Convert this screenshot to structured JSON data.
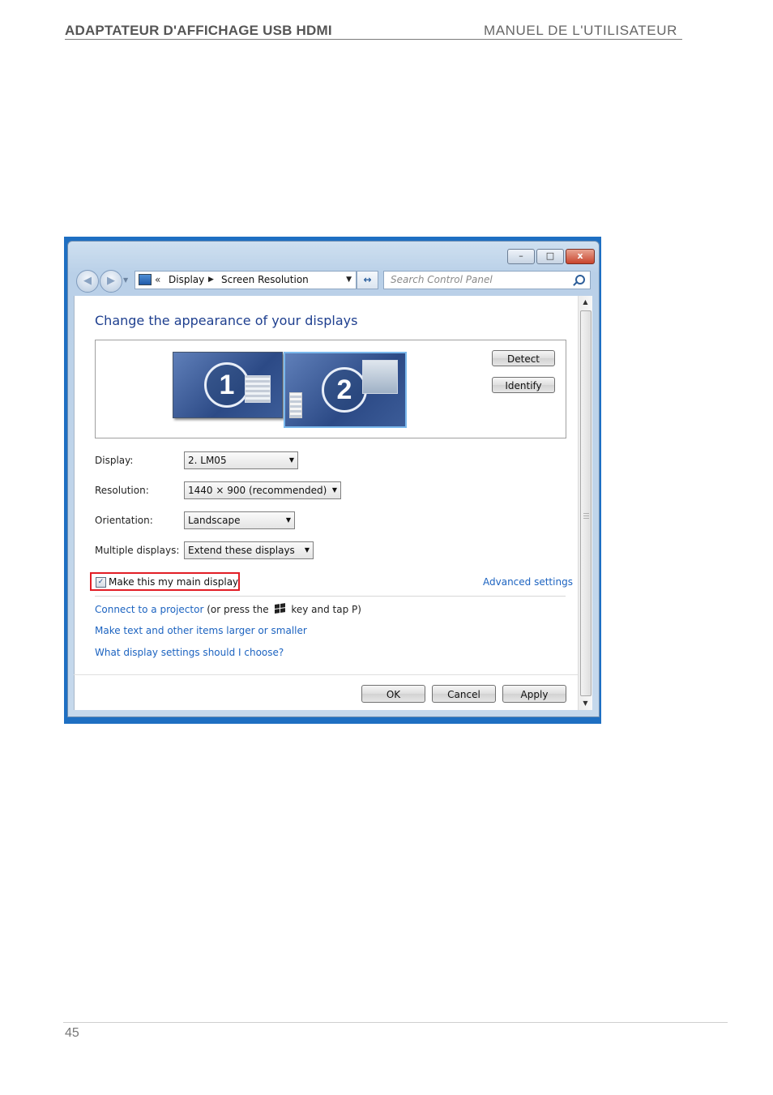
{
  "page": {
    "header_left": "ADAPTATEUR D'AFFICHAGE USB HDMI",
    "header_right": "MANUEL DE L'UTILISATEUR",
    "page_number": "45"
  },
  "window": {
    "titlebar_buttons": {
      "minimize": "–",
      "maximize": "□",
      "close": "x"
    },
    "address_bar": {
      "icon": "control-panel-icon",
      "overflow": "«",
      "crumbs": [
        "Display",
        "Screen Resolution"
      ],
      "separator": "▶",
      "dropdown": "▼"
    },
    "refresh_label": "↔",
    "search": {
      "placeholder": "Search Control Panel",
      "icon": "search-icon"
    },
    "title": "Change the appearance of your displays",
    "monitors": [
      {
        "number": "1"
      },
      {
        "number": "2"
      }
    ],
    "detect_label": "Detect",
    "identify_label": "Identify",
    "fields": [
      {
        "label": "Display:",
        "value": "2. LM05"
      },
      {
        "label": "Resolution:",
        "value": "1440 × 900 (recommended)"
      },
      {
        "label": "Orientation:",
        "value": "Landscape"
      },
      {
        "label": "Multiple displays:",
        "value": "Extend these displays"
      }
    ],
    "main_display_checkbox": {
      "label": "Make this my main display",
      "checked": "✓"
    },
    "advanced_settings": "Advanced settings",
    "projector": {
      "link": "Connect to a projector",
      "text_before": "(or press the",
      "text_after": "key and tap P)"
    },
    "link_text_larger": "Make text and other items larger or smaller",
    "link_which_settings": "What display settings should I choose?",
    "buttons": {
      "ok": "OK",
      "cancel": "Cancel",
      "apply": "Apply"
    },
    "highlight_color": "#e21e26",
    "link_color": "#1c63c0",
    "title_color": "#1e3f8f"
  }
}
